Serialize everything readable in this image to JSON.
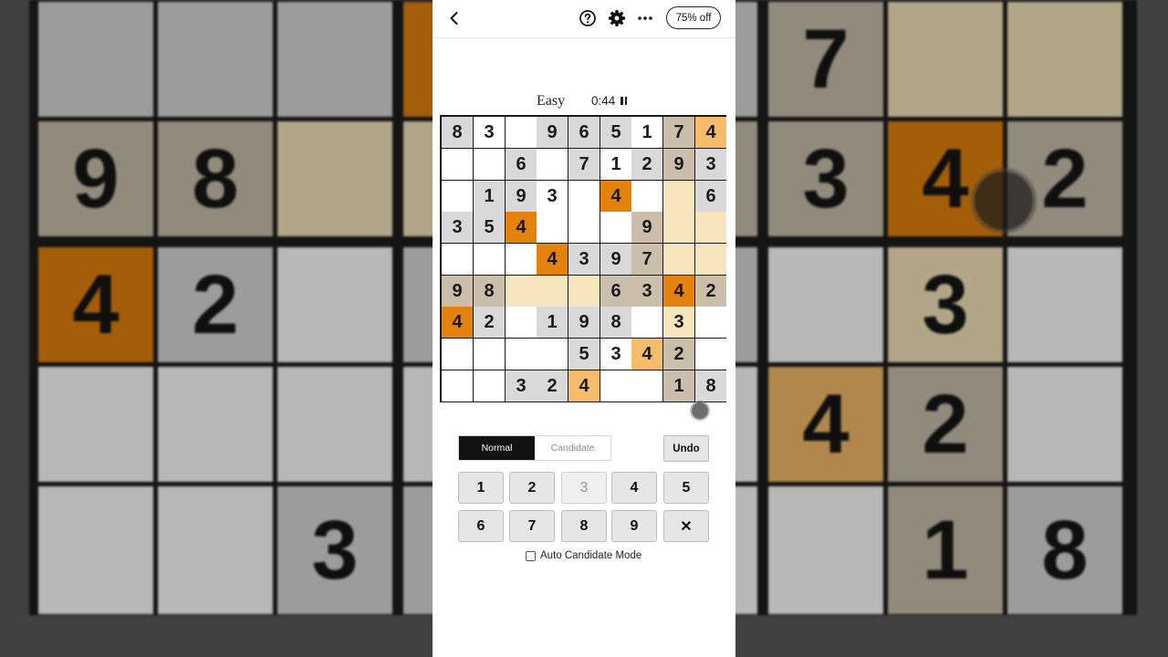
{
  "colors": {
    "given": "#d9d9d9",
    "related": "#f7e6bd",
    "same_number": "#e3830e",
    "entered_match": "#f7bc6b",
    "tan": "#cbbfac",
    "empty": "#ffffff"
  },
  "header": {
    "back_icon": "chevron-left-icon",
    "help_icon": "question-circle-icon",
    "settings_icon": "gear-icon",
    "more_icon": "ellipsis-icon",
    "promo_label": "75% off"
  },
  "game": {
    "difficulty": "Easy",
    "timer": "0:44",
    "pause_icon": "pause-icon"
  },
  "board": [
    [
      {
        "v": "8",
        "s": "given"
      },
      {
        "v": "3",
        "s": "empty"
      },
      {
        "v": "",
        "s": "empty"
      },
      {
        "v": "9",
        "s": "given"
      },
      {
        "v": "6",
        "s": "given"
      },
      {
        "v": "5",
        "s": "given"
      },
      {
        "v": "1",
        "s": "empty"
      },
      {
        "v": "7",
        "s": "tan"
      },
      {
        "v": "4",
        "s": "entered_match"
      }
    ],
    [
      {
        "v": "",
        "s": "empty"
      },
      {
        "v": "",
        "s": "empty"
      },
      {
        "v": "6",
        "s": "given"
      },
      {
        "v": "",
        "s": "empty"
      },
      {
        "v": "7",
        "s": "given"
      },
      {
        "v": "1",
        "s": "empty"
      },
      {
        "v": "2",
        "s": "given"
      },
      {
        "v": "9",
        "s": "tan"
      },
      {
        "v": "3",
        "s": "given"
      }
    ],
    [
      {
        "v": "",
        "s": "empty"
      },
      {
        "v": "1",
        "s": "given"
      },
      {
        "v": "9",
        "s": "given"
      },
      {
        "v": "3",
        "s": "empty"
      },
      {
        "v": "",
        "s": "empty"
      },
      {
        "v": "4",
        "s": "same_number"
      },
      {
        "v": "",
        "s": "empty"
      },
      {
        "v": "",
        "s": "related"
      },
      {
        "v": "6",
        "s": "given"
      }
    ],
    [
      {
        "v": "3",
        "s": "given"
      },
      {
        "v": "5",
        "s": "given"
      },
      {
        "v": "4",
        "s": "same_number"
      },
      {
        "v": "",
        "s": "empty"
      },
      {
        "v": "",
        "s": "empty"
      },
      {
        "v": "",
        "s": "empty"
      },
      {
        "v": "9",
        "s": "tan"
      },
      {
        "v": "",
        "s": "related"
      },
      {
        "v": "",
        "s": "related"
      }
    ],
    [
      {
        "v": "",
        "s": "empty"
      },
      {
        "v": "",
        "s": "empty"
      },
      {
        "v": "",
        "s": "empty"
      },
      {
        "v": "4",
        "s": "same_number"
      },
      {
        "v": "3",
        "s": "given"
      },
      {
        "v": "9",
        "s": "given"
      },
      {
        "v": "7",
        "s": "tan"
      },
      {
        "v": "",
        "s": "related"
      },
      {
        "v": "",
        "s": "related"
      }
    ],
    [
      {
        "v": "9",
        "s": "tan"
      },
      {
        "v": "8",
        "s": "tan"
      },
      {
        "v": "",
        "s": "related"
      },
      {
        "v": "",
        "s": "related"
      },
      {
        "v": "",
        "s": "related"
      },
      {
        "v": "6",
        "s": "tan"
      },
      {
        "v": "3",
        "s": "tan"
      },
      {
        "v": "4",
        "s": "same_number"
      },
      {
        "v": "2",
        "s": "tan"
      }
    ],
    [
      {
        "v": "4",
        "s": "same_number"
      },
      {
        "v": "2",
        "s": "given"
      },
      {
        "v": "",
        "s": "empty"
      },
      {
        "v": "1",
        "s": "given"
      },
      {
        "v": "9",
        "s": "given"
      },
      {
        "v": "8",
        "s": "given"
      },
      {
        "v": "",
        "s": "empty"
      },
      {
        "v": "3",
        "s": "related"
      },
      {
        "v": "",
        "s": "empty"
      }
    ],
    [
      {
        "v": "",
        "s": "empty"
      },
      {
        "v": "",
        "s": "empty"
      },
      {
        "v": "",
        "s": "empty"
      },
      {
        "v": "",
        "s": "empty"
      },
      {
        "v": "5",
        "s": "given"
      },
      {
        "v": "3",
        "s": "empty"
      },
      {
        "v": "4",
        "s": "entered_match"
      },
      {
        "v": "2",
        "s": "tan"
      },
      {
        "v": "",
        "s": "empty"
      }
    ],
    [
      {
        "v": "",
        "s": "empty"
      },
      {
        "v": "",
        "s": "empty"
      },
      {
        "v": "3",
        "s": "given"
      },
      {
        "v": "2",
        "s": "given"
      },
      {
        "v": "4",
        "s": "entered_match"
      },
      {
        "v": "",
        "s": "empty"
      },
      {
        "v": "",
        "s": "empty"
      },
      {
        "v": "1",
        "s": "tan"
      },
      {
        "v": "8",
        "s": "given"
      }
    ]
  ],
  "controls": {
    "mode_normal": "Normal",
    "mode_candidate": "Candidate",
    "undo_label": "Undo",
    "keys": [
      {
        "label": "1",
        "disabled": false
      },
      {
        "label": "2",
        "disabled": false
      },
      {
        "label": "3",
        "disabled": true
      },
      {
        "label": "4",
        "disabled": false
      },
      {
        "label": "5",
        "disabled": false
      },
      {
        "label": "6",
        "disabled": false
      },
      {
        "label": "7",
        "disabled": false
      },
      {
        "label": "8",
        "disabled": false
      },
      {
        "label": "9",
        "disabled": false
      },
      {
        "label": "✕",
        "disabled": false
      }
    ],
    "auto_candidate_label": "Auto Candidate Mode",
    "auto_candidate_checked": false
  }
}
